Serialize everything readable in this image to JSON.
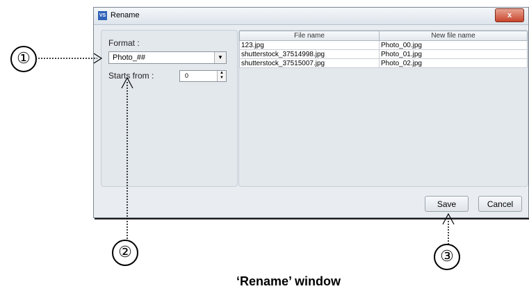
{
  "window": {
    "app_icon": "VS",
    "title": "Rename",
    "close_glyph": "x"
  },
  "settings": {
    "format_label": "Format :",
    "format_value": "Photo_##",
    "starts_label": "Starts from :",
    "starts_value": "0"
  },
  "file_table": {
    "columns": [
      "File name",
      "New file name"
    ],
    "rows": [
      [
        "123.jpg",
        "Photo_00.jpg"
      ],
      [
        "shutterstock_37514998.jpg",
        "Photo_01.jpg"
      ],
      [
        "shutterstock_37515007.jpg",
        "Photo_02.jpg"
      ]
    ]
  },
  "buttons": {
    "save": "Save",
    "cancel": "Cancel"
  },
  "annotations": {
    "callout_1": "①",
    "callout_2": "②",
    "callout_3": "③",
    "caption": "‘Rename’ window"
  }
}
